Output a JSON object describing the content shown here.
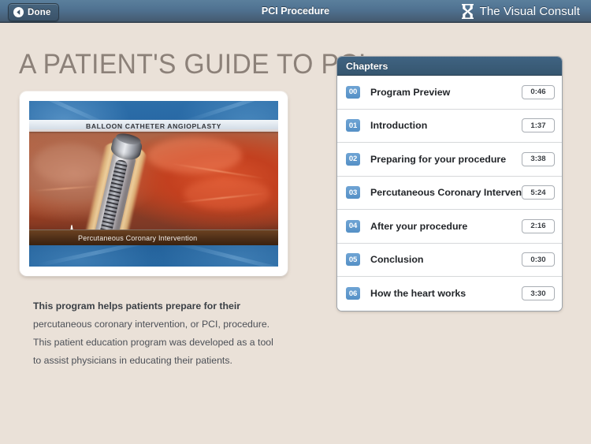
{
  "toolbar": {
    "done_label": "Done",
    "title": "PCI Procedure",
    "brand_text": "The Visual Consult",
    "back_icon": "back-chevron-icon",
    "brand_icon": "visual-consult-logo-icon",
    "gradient_top": "#5A7F9C",
    "gradient_bottom": "#33414F"
  },
  "page": {
    "background_color": "#EAE1D8",
    "title": "A PATIENT'S GUIDE TO PCI",
    "title_color": "#8C8179"
  },
  "video": {
    "overlay_title": "BALLOON CATHETER ANGIOPLASTY",
    "caption": "Percutaneous Coronary Intervention",
    "ekg_icon": "ekg-waveform-icon",
    "frame_color": "#FFFFFF"
  },
  "body_copy": {
    "lines": [
      "This program helps patients prepare for their",
      "percutaneous coronary intervention, or PCI, procedure.",
      "This patient education program was developed as a tool",
      "to assist physicians in educating their patients."
    ]
  },
  "chapters": {
    "header": "Chapters",
    "accent_color": "#5590C6",
    "header_color": "#36566F",
    "items": [
      {
        "num": "00",
        "title": "Program Preview",
        "time": "0:46"
      },
      {
        "num": "01",
        "title": "Introduction",
        "time": "1:37"
      },
      {
        "num": "02",
        "title": "Preparing for your procedure",
        "time": "3:38"
      },
      {
        "num": "03",
        "title": "Percutaneous Coronary Intervention",
        "time": "5:24"
      },
      {
        "num": "04",
        "title": "After your procedure",
        "time": "2:16"
      },
      {
        "num": "05",
        "title": "Conclusion",
        "time": "0:30"
      },
      {
        "num": "06",
        "title": "How the heart works",
        "time": "3:30"
      }
    ]
  }
}
